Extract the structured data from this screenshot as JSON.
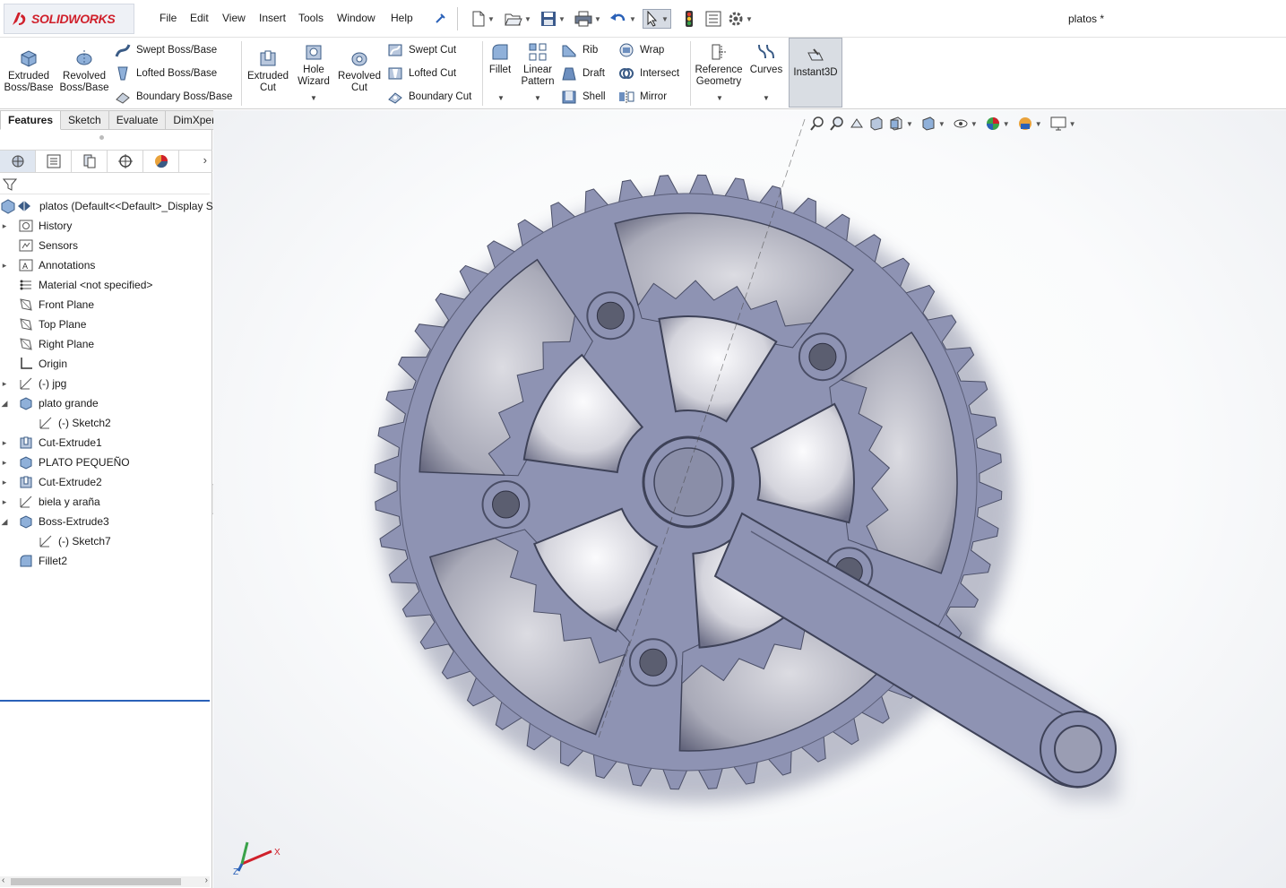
{
  "app": {
    "brand": "SOLIDWORKS",
    "menu": [
      "File",
      "Edit",
      "View",
      "Insert",
      "Tools",
      "Window",
      "Help"
    ],
    "document_title": "platos *"
  },
  "quick_access": [
    "new-icon",
    "open-icon",
    "save-icon",
    "print-icon",
    "undo-icon",
    "select-icon",
    "rebuild-icon",
    "file-properties-icon",
    "options-icon"
  ],
  "ribbon": {
    "extruded_boss": "Extruded Boss/Base",
    "revolved_boss": "Revolved Boss/Base",
    "swept_boss": "Swept Boss/Base",
    "lofted_boss": "Lofted Boss/Base",
    "boundary_boss": "Boundary Boss/Base",
    "extruded_cut": "Extruded Cut",
    "hole_wizard": "Hole Wizard",
    "revolved_cut": "Revolved Cut",
    "swept_cut": "Swept Cut",
    "lofted_cut": "Lofted Cut",
    "boundary_cut": "Boundary Cut",
    "fillet": "Fillet",
    "linear_pattern": "Linear Pattern",
    "rib": "Rib",
    "draft": "Draft",
    "shell": "Shell",
    "wrap": "Wrap",
    "intersect": "Intersect",
    "mirror": "Mirror",
    "reference_geometry": "Reference Geometry",
    "curves": "Curves",
    "instant3d": "Instant3D"
  },
  "tabs": [
    "Features",
    "Sketch",
    "Evaluate",
    "DimXpert"
  ],
  "active_tab": "Features",
  "panel_tabs": [
    "feature-manager-icon",
    "property-manager-icon",
    "configuration-manager-icon",
    "dimxpert-manager-icon",
    "display-manager-icon"
  ],
  "tree": [
    {
      "label": "platos  (Default<<Default>_Display S",
      "icon": "part-icon",
      "expand": "",
      "indent": 0
    },
    {
      "label": "History",
      "icon": "history-icon",
      "expand": "collapsed",
      "indent": 1
    },
    {
      "label": "Sensors",
      "icon": "sensors-icon",
      "expand": "",
      "indent": 1
    },
    {
      "label": "Annotations",
      "icon": "annotations-icon",
      "expand": "collapsed",
      "indent": 1
    },
    {
      "label": "Material <not specified>",
      "icon": "material-icon",
      "expand": "",
      "indent": 1
    },
    {
      "label": "Front Plane",
      "icon": "plane-icon",
      "expand": "",
      "indent": 1
    },
    {
      "label": "Top Plane",
      "icon": "plane-icon",
      "expand": "",
      "indent": 1
    },
    {
      "label": "Right Plane",
      "icon": "plane-icon",
      "expand": "",
      "indent": 1
    },
    {
      "label": "Origin",
      "icon": "origin-icon",
      "expand": "",
      "indent": 1
    },
    {
      "label": "(-) jpg",
      "icon": "sketch-icon",
      "expand": "collapsed",
      "indent": 1
    },
    {
      "label": "plato grande",
      "icon": "boss-extrude-icon",
      "expand": "expanded",
      "indent": 1
    },
    {
      "label": "(-) Sketch2",
      "icon": "sketch-icon",
      "expand": "",
      "indent": 2
    },
    {
      "label": "Cut-Extrude1",
      "icon": "cut-extrude-icon",
      "expand": "collapsed",
      "indent": 1
    },
    {
      "label": "PLATO PEQUEÑO",
      "icon": "boss-extrude-icon",
      "expand": "collapsed",
      "indent": 1
    },
    {
      "label": "Cut-Extrude2",
      "icon": "cut-extrude-icon",
      "expand": "collapsed",
      "indent": 1
    },
    {
      "label": "biela y araña",
      "icon": "sketch-icon",
      "expand": "collapsed",
      "indent": 1
    },
    {
      "label": "Boss-Extrude3",
      "icon": "boss-extrude-icon",
      "expand": "expanded",
      "indent": 1
    },
    {
      "label": "(-) Sketch7",
      "icon": "sketch-icon",
      "expand": "",
      "indent": 2
    },
    {
      "label": "Fillet2",
      "icon": "fillet-icon",
      "expand": "",
      "indent": 1
    }
  ],
  "heads_up": [
    "zoom-to-fit-icon",
    "zoom-to-area-icon",
    "previous-view-icon",
    "section-view-icon",
    "view-orientation-icon",
    "display-style-icon",
    "hide-show-items-icon",
    "edit-appearance-icon",
    "apply-scene-icon",
    "view-settings-icon"
  ],
  "triad": {
    "x": "X",
    "z": "Z"
  },
  "colors": {
    "model": "#8e93b3",
    "accent": "#d0202b",
    "selection": "#2a61b8"
  }
}
